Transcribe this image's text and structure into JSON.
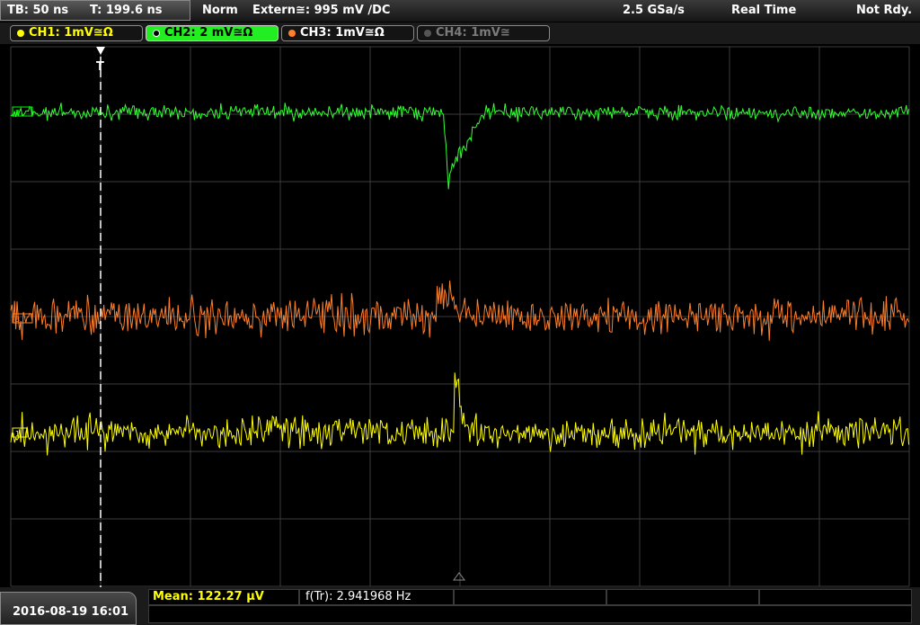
{
  "status": {
    "timebase": "TB: 50 ns",
    "trigger_time": "T: 199.6 ns",
    "mode": "Norm",
    "trigger_source": "Extern≅: 995 mV ∕DC",
    "sample_rate": "2.5 GSa/s",
    "acq_mode": "Real Time",
    "run_state": "Not Rdy."
  },
  "channels": [
    {
      "label": "CH1: 1mV≅Ω",
      "color": "#ffff00",
      "active": true
    },
    {
      "label": "CH2: 2 mV≅Ω",
      "color": "#00ff00",
      "active": true,
      "selected": true
    },
    {
      "label": "CH3: 1mV≅Ω",
      "color": "#ff7f2a",
      "active": true
    },
    {
      "label": "CH4: 1mV≅",
      "color": "#7a7a7a",
      "active": false
    }
  ],
  "measurements": {
    "mean": "Mean: 122.27 µV",
    "frequency": "f(Tr): 2.941968 Hz"
  },
  "datetime": "2016-08-19 16:01",
  "trace_colors": {
    "ch1": "#ffff00",
    "ch2": "#33ff33",
    "ch3": "#ff7f2a",
    "grid": "#3c3c3c"
  }
}
